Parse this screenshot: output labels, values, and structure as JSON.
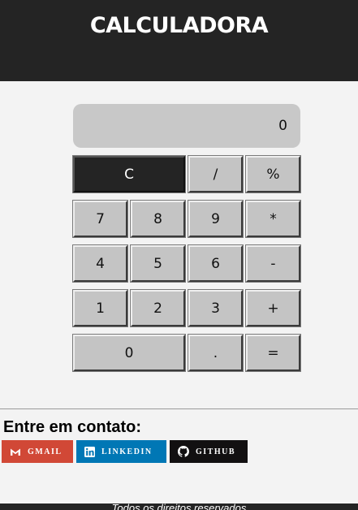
{
  "header": {
    "title": "CALCULADORA"
  },
  "calculator": {
    "display_value": "0",
    "keys": {
      "clear": "C",
      "divide": "/",
      "percent": "%",
      "seven": "7",
      "eight": "8",
      "nine": "9",
      "multiply": "*",
      "four": "4",
      "five": "5",
      "six": "6",
      "minus": "-",
      "one": "1",
      "two": "2",
      "three": "3",
      "plus": "+",
      "zero": "0",
      "decimal": ".",
      "equals": "="
    }
  },
  "contact": {
    "title": "Entre em contato:",
    "links": [
      {
        "label": "GMAIL",
        "icon": "gmail-icon",
        "color": "#d14836"
      },
      {
        "label": "LINKEDIN",
        "icon": "linkedin-icon",
        "color": "#0077b5"
      },
      {
        "label": "GITHUB",
        "icon": "github-icon",
        "color": "#121011"
      }
    ]
  },
  "footer": {
    "text": "Todos os direitos reservados"
  },
  "colors": {
    "dark": "#242424",
    "key": "#c4c4c4",
    "display": "#c8c8c8",
    "background": "#f3f3f3"
  }
}
